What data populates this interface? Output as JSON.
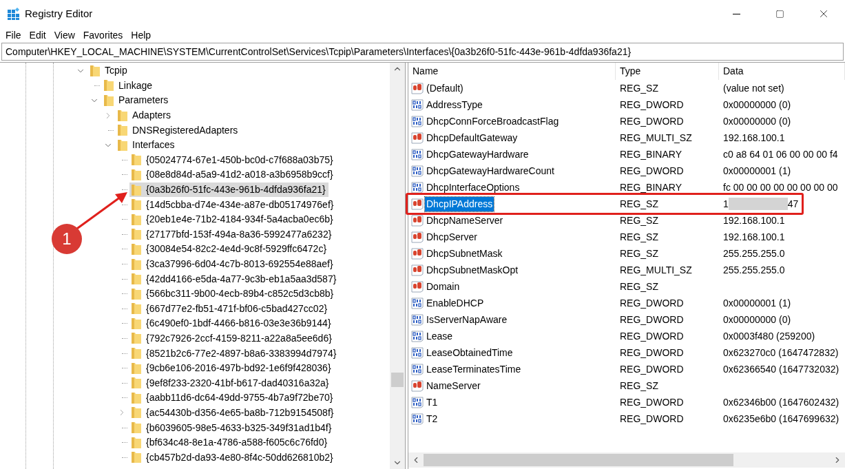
{
  "window": {
    "title": "Registry Editor"
  },
  "menu": [
    "File",
    "Edit",
    "View",
    "Favorites",
    "Help"
  ],
  "address": "Computer\\HKEY_LOCAL_MACHINE\\SYSTEM\\CurrentControlSet\\Services\\Tcpip\\Parameters\\Interfaces\\{0a3b26f0-51fc-443e-961b-4dfda936fa21}",
  "tree": [
    {
      "label": "Tcpip",
      "expanded": true,
      "selected": false,
      "children": [
        {
          "label": "Linkage",
          "selected": false
        },
        {
          "label": "Parameters",
          "expanded": true,
          "selected": false,
          "children": [
            {
              "label": "Adapters",
              "expanded": false,
              "selected": false
            },
            {
              "label": "DNSRegisteredAdapters",
              "selected": false
            },
            {
              "label": "Interfaces",
              "expanded": true,
              "selected": false,
              "children": [
                {
                  "label": "{05024774-67e1-450b-bc0d-c7f688a03b75}",
                  "selected": false
                },
                {
                  "label": "{08e8d84d-a5a9-41d2-a018-a3b6958b9ccf}",
                  "selected": false
                },
                {
                  "label": "{0a3b26f0-51fc-443e-961b-4dfda936fa21}",
                  "selected": true
                },
                {
                  "label": "{14d5cbba-d74e-434e-a87e-db05174976ef}",
                  "selected": false
                },
                {
                  "label": "{20eb1e4e-71b2-4184-934f-5a4acba0ec6b}",
                  "selected": false
                },
                {
                  "label": "{27177bfd-153f-494a-8a36-5992477a6232}",
                  "selected": false
                },
                {
                  "label": "{30084e54-82c2-4e4d-9c8f-5929ffc6472c}",
                  "selected": false
                },
                {
                  "label": "{3ca37996-6d04-4c7b-8013-692554e88aef}",
                  "selected": false
                },
                {
                  "label": "{42dd4166-e5da-4a77-9c3b-eb1a5aa3d587}",
                  "selected": false
                },
                {
                  "label": "{566bc311-9b00-4ecb-89b4-c852c5d3cb8b}",
                  "selected": false
                },
                {
                  "label": "{667d77e2-fb51-471f-bf06-c5bad427cc02}",
                  "selected": false
                },
                {
                  "label": "{6c490ef0-1bdf-4466-b816-03e3e36b9144}",
                  "selected": false
                },
                {
                  "label": "{792c7926-2ccf-4159-8211-a22a8a5ee6d6}",
                  "selected": false
                },
                {
                  "label": "{8521b2c6-77e2-4897-b8a6-3383994d7974}",
                  "selected": false
                },
                {
                  "label": "{9cb6e106-2016-497b-bd92-1e6f9f428036}",
                  "selected": false
                },
                {
                  "label": "{9ef8f233-2320-41bf-b617-dad40316a32a}",
                  "selected": false
                },
                {
                  "label": "{aabb11d6-dc64-49dd-9755-4b7a9f72be70}",
                  "selected": false
                },
                {
                  "label": "{ac54430b-d356-4e65-ba8b-712b9154508f}",
                  "expanded": false,
                  "selected": false
                },
                {
                  "label": "{b6039605-98e5-4633-b325-349f31ad1b4f}",
                  "selected": false
                },
                {
                  "label": "{bf634c48-8e1a-4786-a588-f605c6c76fd0}",
                  "selected": false
                },
                {
                  "label": "{cb457b2d-da93-4e80-8f4c-50dd626810b2}",
                  "selected": false
                }
              ]
            }
          ]
        }
      ]
    }
  ],
  "values": {
    "columns": [
      "Name",
      "Type",
      "Data"
    ],
    "rows": [
      {
        "name": "(Default)",
        "type": "REG_SZ",
        "data": "(value not set)",
        "kind": "string",
        "selected": false,
        "annotated": false,
        "redacted": false
      },
      {
        "name": "AddressType",
        "type": "REG_DWORD",
        "data": "0x00000000 (0)",
        "kind": "binary",
        "selected": false,
        "annotated": false,
        "redacted": false
      },
      {
        "name": "DhcpConnForceBroadcastFlag",
        "type": "REG_DWORD",
        "data": "0x00000000 (0)",
        "kind": "binary",
        "selected": false,
        "annotated": false,
        "redacted": false
      },
      {
        "name": "DhcpDefaultGateway",
        "type": "REG_MULTI_SZ",
        "data": "192.168.100.1",
        "kind": "string",
        "selected": false,
        "annotated": false,
        "redacted": false
      },
      {
        "name": "DhcpGatewayHardware",
        "type": "REG_BINARY",
        "data": "c0 a8 64 01 06 00 00 00 f4",
        "kind": "binary",
        "selected": false,
        "annotated": false,
        "redacted": false
      },
      {
        "name": "DhcpGatewayHardwareCount",
        "type": "REG_DWORD",
        "data": "0x00000001 (1)",
        "kind": "binary",
        "selected": false,
        "annotated": false,
        "redacted": false
      },
      {
        "name": "DhcpInterfaceOptions",
        "type": "REG_BINARY",
        "data": "fc 00 00 00 00 00 00 00 00",
        "kind": "binary",
        "selected": false,
        "annotated": false,
        "redacted": false
      },
      {
        "name": "DhcpIPAddress",
        "type": "REG_SZ",
        "data": "1",
        "data_tail": "47",
        "kind": "string",
        "selected": true,
        "annotated": true,
        "redacted": true
      },
      {
        "name": "DhcpNameServer",
        "type": "REG_SZ",
        "data": "192.168.100.1",
        "kind": "string",
        "selected": false,
        "annotated": false,
        "redacted": false
      },
      {
        "name": "DhcpServer",
        "type": "REG_SZ",
        "data": "192.168.100.1",
        "kind": "string",
        "selected": false,
        "annotated": false,
        "redacted": false
      },
      {
        "name": "DhcpSubnetMask",
        "type": "REG_SZ",
        "data": "255.255.255.0",
        "kind": "string",
        "selected": false,
        "annotated": false,
        "redacted": false
      },
      {
        "name": "DhcpSubnetMaskOpt",
        "type": "REG_MULTI_SZ",
        "data": "255.255.255.0",
        "kind": "string",
        "selected": false,
        "annotated": false,
        "redacted": false
      },
      {
        "name": "Domain",
        "type": "REG_SZ",
        "kind": "string",
        "selected": false,
        "annotated": false,
        "redacted": false
      },
      {
        "name": "EnableDHCP",
        "type": "REG_DWORD",
        "data": "0x00000001 (1)",
        "kind": "binary",
        "selected": false,
        "annotated": false,
        "redacted": false
      },
      {
        "name": "IsServerNapAware",
        "type": "REG_DWORD",
        "data": "0x00000000 (0)",
        "kind": "binary",
        "selected": false,
        "annotated": false,
        "redacted": false
      },
      {
        "name": "Lease",
        "type": "REG_DWORD",
        "data": "0x0003f480 (259200)",
        "kind": "binary",
        "selected": false,
        "annotated": false,
        "redacted": false
      },
      {
        "name": "LeaseObtainedTime",
        "type": "REG_DWORD",
        "data": "0x623270c0 (1647472832)",
        "kind": "binary",
        "selected": false,
        "annotated": false,
        "redacted": false
      },
      {
        "name": "LeaseTerminatesTime",
        "type": "REG_DWORD",
        "data": "0x62366540 (1647732032)",
        "kind": "binary",
        "selected": false,
        "annotated": false,
        "redacted": false
      },
      {
        "name": "NameServer",
        "type": "REG_SZ",
        "kind": "string",
        "selected": false,
        "annotated": false,
        "redacted": false
      },
      {
        "name": "T1",
        "type": "REG_DWORD",
        "data": "0x62346b00 (1647602432)",
        "kind": "binary",
        "selected": false,
        "annotated": false,
        "redacted": false
      },
      {
        "name": "T2",
        "type": "REG_DWORD",
        "data": "0x6235e6b0 (1647699632)",
        "kind": "binary",
        "selected": false,
        "annotated": false,
        "redacted": false
      }
    ]
  },
  "callout": {
    "label": "1"
  }
}
